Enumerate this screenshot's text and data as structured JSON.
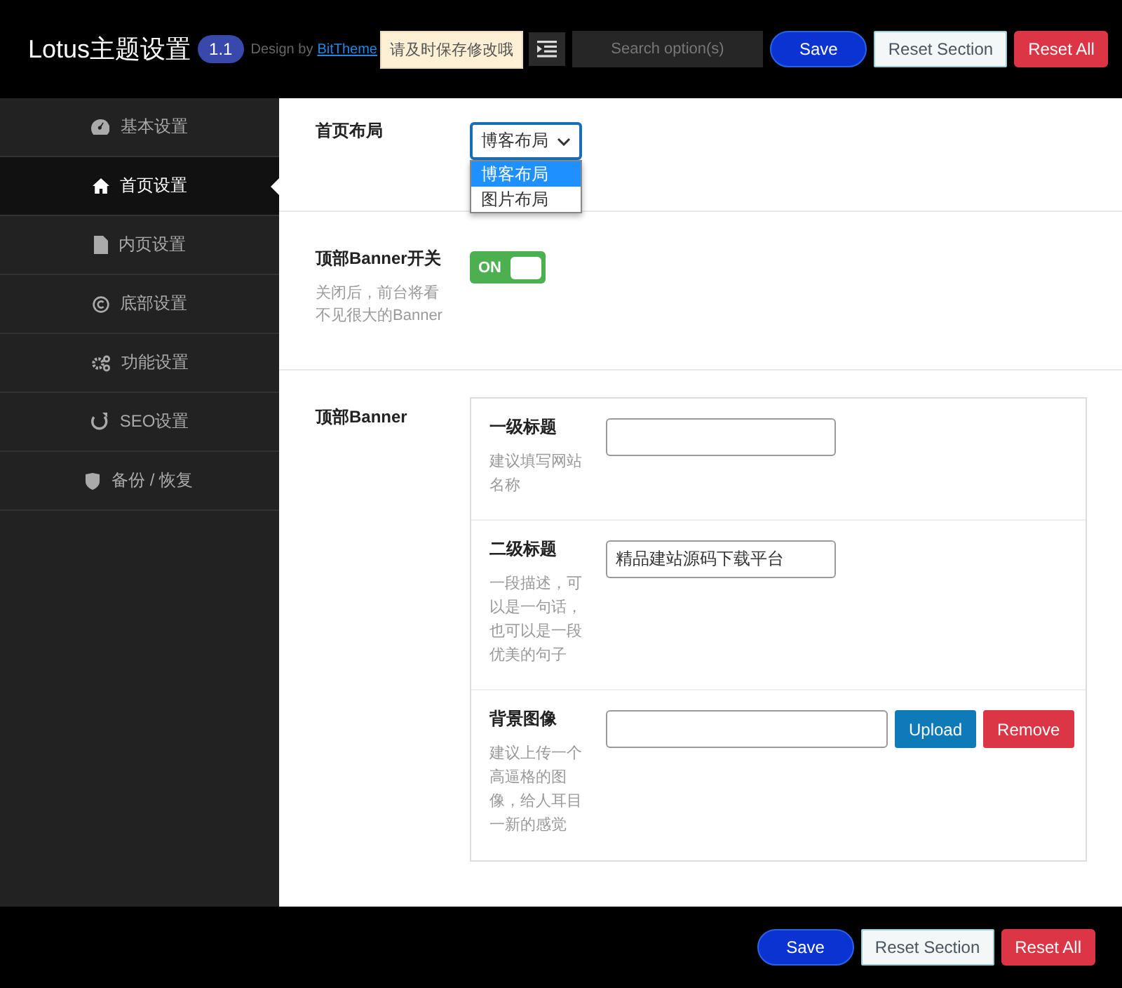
{
  "header": {
    "title": "Lotus主题设置",
    "version": "1.1",
    "credit": "Design by",
    "credit_link": "BitTheme",
    "notice": "请及时保存修改哦",
    "search": {
      "placeholder": "Search option(s)"
    },
    "buttons": [
      {
        "kind": "save",
        "label": "Save"
      },
      {
        "kind": "reset_section",
        "label": "Reset Section"
      },
      {
        "kind": "reset_all",
        "label": "Reset All"
      }
    ]
  },
  "sidebar": {
    "items": [
      {
        "kind": "dashboard",
        "label": "基本设置",
        "selected": false
      },
      {
        "kind": "home",
        "label": "首页设置",
        "selected": true
      },
      {
        "kind": "file",
        "label": "内页设置",
        "selected": false
      },
      {
        "kind": "copyright",
        "label": "底部设置",
        "selected": false
      },
      {
        "kind": "gears",
        "label": "功能设置",
        "selected": false
      },
      {
        "kind": "seo",
        "label": "SEO设置",
        "selected": false
      },
      {
        "kind": "shield",
        "label": "备份 / 恢复",
        "selected": false
      }
    ]
  },
  "fields": [
    {
      "kind": "select",
      "label": "首页布局",
      "value": "博客布局",
      "expanded": true,
      "options": [
        {
          "label": "博客布局",
          "selected": true
        },
        {
          "label": "图片布局",
          "selected": false
        }
      ]
    },
    {
      "kind": "switch",
      "label": "顶部Banner开关",
      "description": "关闭后，前台将看不见很大的Banner",
      "on": true,
      "on_label": "ON"
    },
    {
      "kind": "group",
      "label": "顶部Banner",
      "subfields": [
        {
          "kind": "text",
          "label": "一级标题",
          "description": "建议填写网站名称"
        },
        {
          "kind": "text",
          "label": "二级标题",
          "description": "一段描述，可以是一句话，也可以是一段优美的句子",
          "value": "精品建站源码下载平台"
        },
        {
          "kind": "upload",
          "label": "背景图像",
          "description": "建议上传一个高逼格的图像，给人耳目一新的感觉",
          "buttons": [
            {
              "kind": "upload",
              "label": "Upload"
            },
            {
              "kind": "remove",
              "label": "Remove"
            }
          ]
        }
      ]
    }
  ],
  "footer": {
    "buttons": [
      {
        "kind": "save",
        "label": "Save"
      },
      {
        "kind": "reset_section",
        "label": "Reset Section"
      },
      {
        "kind": "reset_all",
        "label": "Reset All"
      }
    ]
  }
}
